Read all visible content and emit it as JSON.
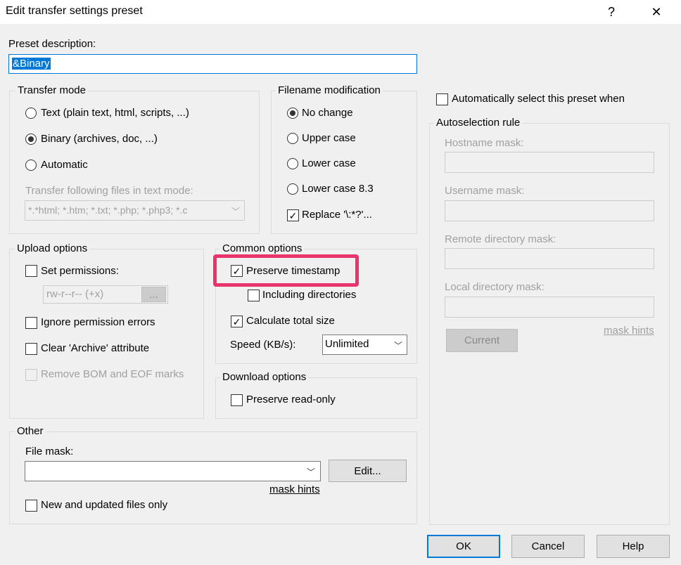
{
  "window": {
    "title": "Edit transfer settings preset",
    "help_glyph": "?",
    "close_glyph": "✕"
  },
  "preset": {
    "label": "Preset description:",
    "value": "&Binary"
  },
  "transfer_mode": {
    "title": "Transfer mode",
    "options": [
      "Text (plain text, html, scripts, ...)",
      "Binary (archives, doc, ...)",
      "Automatic"
    ],
    "selected": 1,
    "text_mode_label": "Transfer following files in text mode:",
    "text_mode_value": "*.*html; *.htm; *.txt; *.php; *.php3; *.c"
  },
  "filename_mod": {
    "title": "Filename modification",
    "options": [
      "No change",
      "Upper case",
      "Lower case",
      "Lower case 8.3"
    ],
    "selected": 0,
    "replace_label": "Replace '\\:*?'...",
    "replace_checked": true
  },
  "upload": {
    "title": "Upload options",
    "set_permissions": "Set permissions:",
    "permissions_value": "rw-r--r-- (+x)",
    "permissions_button": "...",
    "ignore_errors": "Ignore permission errors",
    "clear_archive": "Clear 'Archive' attribute",
    "remove_bom": "Remove BOM and EOF marks"
  },
  "common": {
    "title": "Common options",
    "preserve_timestamp": "Preserve timestamp",
    "including_dirs": "Including directories",
    "calc_size": "Calculate total size",
    "speed_label": "Speed (KB/s):",
    "speed_value": "Unlimited"
  },
  "download": {
    "title": "Download options",
    "preserve_readonly": "Preserve read-only"
  },
  "other": {
    "title": "Other",
    "file_mask_label": "File mask:",
    "edit_button": "Edit...",
    "mask_hints": "mask hints",
    "new_updated": "New and updated files only"
  },
  "auto": {
    "auto_select": "Automatically select this preset when",
    "rule_title": "Autoselection rule",
    "hostname": "Hostname mask:",
    "username": "Username mask:",
    "remote_dir": "Remote directory mask:",
    "local_dir": "Local directory mask:",
    "mask_hints": "mask hints",
    "current_button": "Current"
  },
  "buttons": {
    "ok": "OK",
    "cancel": "Cancel",
    "help": "Help"
  },
  "colors": {
    "highlight": "#e8336d",
    "accent": "#0078d7"
  }
}
